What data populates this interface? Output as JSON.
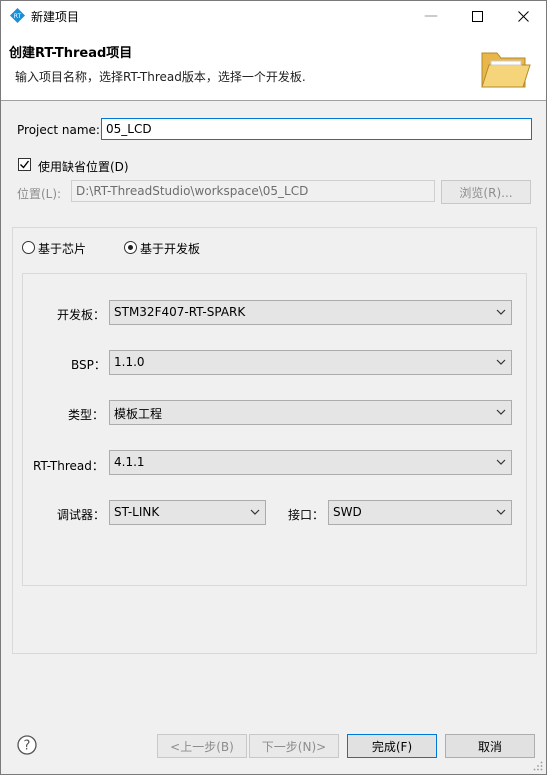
{
  "window": {
    "title": "新建项目",
    "min_glyph": "—",
    "max_glyph": "☐",
    "close_glyph": "✕"
  },
  "banner": {
    "title": "创建RT-Thread项目",
    "description": "输入项目名称，选择RT-Thread版本，选择一个开发板."
  },
  "form": {
    "project_name_label": "Project name:",
    "project_name_value": "05_LCD",
    "use_default_location_label": "使用缺省位置(D)",
    "use_default_location_checked": true,
    "location_label": "位置(L):",
    "location_value": "D:\\RT-ThreadStudio\\workspace\\05_LCD",
    "browse_label": "浏览(R)..."
  },
  "mode": {
    "by_chip_label": "基于芯片",
    "by_board_label": "基于开发板",
    "selected": "by_board"
  },
  "board_settings": {
    "board_label": "开发板：",
    "board_value": "STM32F407-RT-SPARK",
    "bsp_label": "BSP：",
    "bsp_value": "1.1.0",
    "type_label": "类型：",
    "type_value": "模板工程",
    "rtthread_label": "RT-Thread：",
    "rtthread_value": "4.1.1",
    "debugger_label": "调试器：",
    "debugger_value": "ST-LINK",
    "interface_label": "接口：",
    "interface_value": "SWD"
  },
  "footer": {
    "back_label": "<上一步(B)",
    "next_label": "下一步(N)>",
    "finish_label": "完成(F)",
    "cancel_label": "取消"
  },
  "colors": {
    "accent": "#0078d7",
    "folder": "#f3c85b"
  }
}
